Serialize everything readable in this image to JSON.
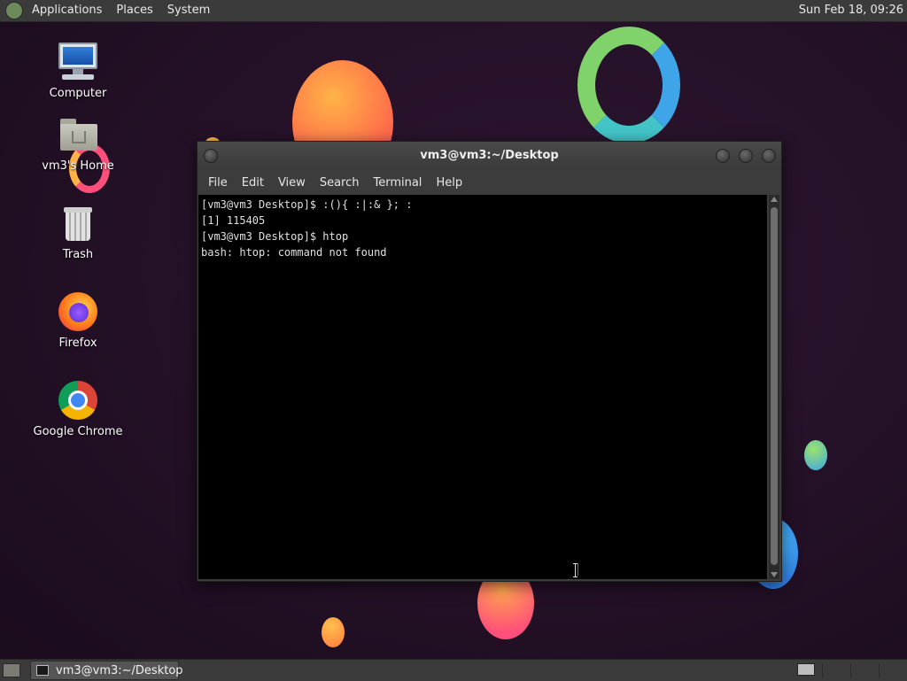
{
  "top_panel": {
    "menus": [
      "Applications",
      "Places",
      "System"
    ],
    "clock": "Sun Feb 18, 09:26"
  },
  "desktop": {
    "icons": [
      {
        "label": "Computer",
        "icon": "computer-icon"
      },
      {
        "label": "vm3's Home",
        "icon": "home-folder-icon"
      },
      {
        "label": "Trash",
        "icon": "trash-icon"
      },
      {
        "label": "Firefox",
        "icon": "firefox-icon"
      },
      {
        "label": "Google Chrome",
        "icon": "chrome-icon"
      }
    ]
  },
  "terminal": {
    "title": "vm3@vm3:~/Desktop",
    "menus": [
      "File",
      "Edit",
      "View",
      "Search",
      "Terminal",
      "Help"
    ],
    "lines": [
      "[vm3@vm3 Desktop]$ :(){ :|:& }; :",
      "[1] 115405",
      "[vm3@vm3 Desktop]$ htop",
      "bash: htop: command not found"
    ]
  },
  "taskbar": {
    "task_label": "vm3@vm3:~/Desktop"
  },
  "colors": {
    "panel": "#3b3b3b",
    "terminal_bg": "#000000",
    "desktop_bg": "#231026"
  }
}
